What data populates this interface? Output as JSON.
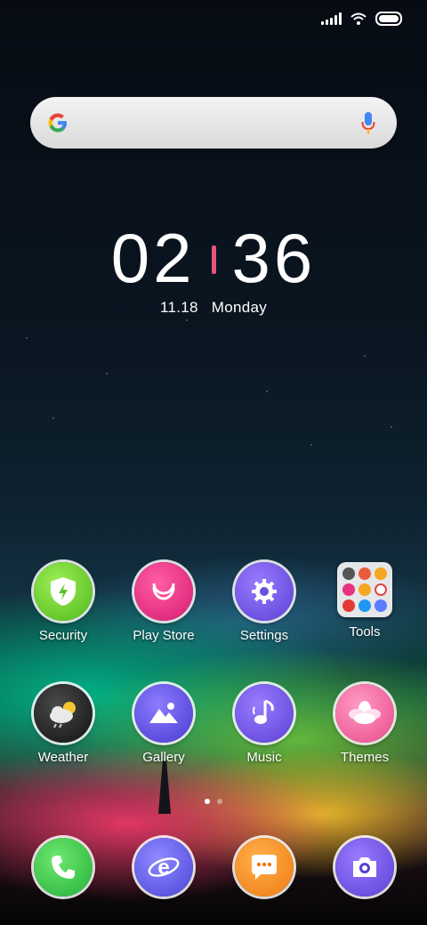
{
  "status_bar": {
    "signal_icon": "signal-icon",
    "wifi_icon": "wifi-icon",
    "battery_icon": "battery-icon"
  },
  "search_widget": {
    "logo_icon": "google-g-icon",
    "mic_icon": "microphone-icon"
  },
  "clock": {
    "hours": "02",
    "minutes": "36",
    "date": "11.18",
    "weekday": "Monday"
  },
  "apps": [
    {
      "label": "Security",
      "icon": "shield-bolt-icon",
      "color": "#6fcf3a"
    },
    {
      "label": "Play Store",
      "icon": "play-store-icon",
      "color": "#e8317f"
    },
    {
      "label": "Settings",
      "icon": "gear-icon",
      "color": "#6a4fe0"
    },
    {
      "label": "Tools",
      "icon": "folder-icon",
      "color": "#f0f0f0"
    },
    {
      "label": "Weather",
      "icon": "cloud-sun-icon",
      "color": "#222222"
    },
    {
      "label": "Gallery",
      "icon": "mountain-icon",
      "color": "#5a5ae0"
    },
    {
      "label": "Music",
      "icon": "music-note-icon",
      "color": "#7a4fe0"
    },
    {
      "label": "Themes",
      "icon": "flower-icon",
      "color": "#f26ea2"
    }
  ],
  "dock": [
    {
      "name": "phone",
      "icon": "phone-icon",
      "color": "#38c94a"
    },
    {
      "name": "browser",
      "icon": "browser-e-icon",
      "color": "#5b5ae6"
    },
    {
      "name": "messages",
      "icon": "chat-bubble-icon",
      "color": "#f58a1f"
    },
    {
      "name": "camera",
      "icon": "camera-icon",
      "color": "#6a4fe0"
    }
  ],
  "page_indicator": {
    "pages": 2,
    "current": 1
  }
}
